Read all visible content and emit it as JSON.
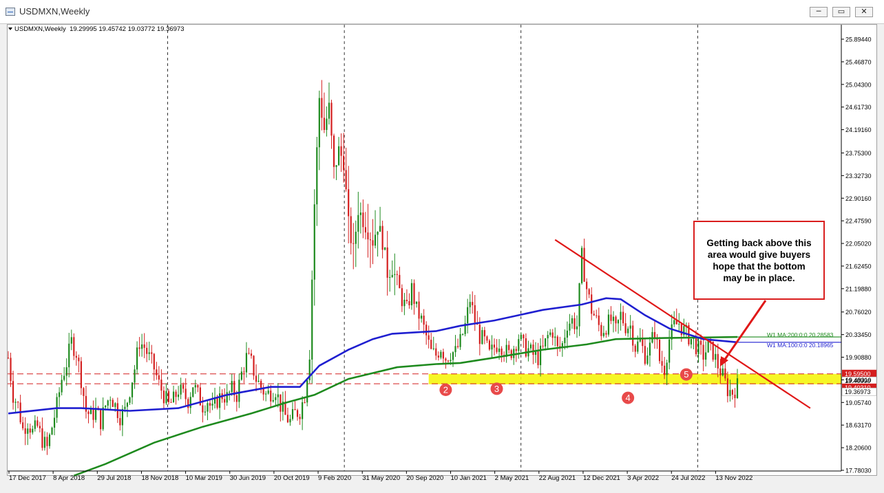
{
  "window": {
    "title": "USDMXN,Weekly",
    "buttons": {
      "minimize": "─",
      "restore": "▭",
      "close": "✕"
    }
  },
  "info_line": {
    "symbol": "USDMXN,Weekly",
    "open": "19.29995",
    "high": "19.45742",
    "low": "19.03772",
    "close": "19.36973"
  },
  "colors": {
    "bull": "#1e8a1e",
    "bear": "#d41f1f",
    "ma100": "#1f1fd0",
    "ma200": "#1e8a1e",
    "trendline": "#e01818",
    "support_zone": "#f5f500",
    "dashed_level": "#d41f1f"
  },
  "chart_data": {
    "type": "line",
    "title": "USDMXN,Weekly",
    "y_axis": {
      "ylim": [
        17.7,
        26.05
      ],
      "tick_labels": [
        "25.89440",
        "25.46870",
        "25.04300",
        "24.61730",
        "24.19160",
        "23.75300",
        "23.32730",
        "22.90160",
        "22.47590",
        "22.05020",
        "21.62450",
        "21.19880",
        "20.76020",
        "20.33450",
        "19.90880",
        "19.48310",
        "19.05740",
        "18.63170",
        "18.20600",
        "17.78030"
      ]
    },
    "x_axis": {
      "tick_labels": [
        "17 Dec 2017",
        "8 Apr 2018",
        "29 Jul 2018",
        "18 Nov 2018",
        "10 Mar 2019",
        "30 Jun 2019",
        "20 Oct 2019",
        "9 Feb 2020",
        "31 May 2020",
        "20 Sep 2020",
        "10 Jan 2021",
        "2 May 2021",
        "22 Aug 2021",
        "12 Dec 2021",
        "3 Apr 2022",
        "24 Jul 2022",
        "13 Nov 2022"
      ],
      "period_grid_after": [
        3,
        7,
        11,
        15
      ]
    },
    "price_path": [
      [
        0,
        19.9
      ],
      [
        2,
        19.2
      ],
      [
        4,
        19.0
      ],
      [
        6,
        18.55
      ],
      [
        8,
        18.7
      ],
      [
        10,
        18.5
      ],
      [
        12,
        18.6
      ],
      [
        14,
        18.35
      ],
      [
        16,
        18.2
      ],
      [
        18,
        18.6
      ],
      [
        20,
        19.0
      ],
      [
        22,
        19.5
      ],
      [
        24,
        19.8
      ],
      [
        26,
        20.2
      ],
      [
        28,
        20.0
      ],
      [
        30,
        19.5
      ],
      [
        32,
        18.9
      ],
      [
        34,
        18.8
      ],
      [
        36,
        18.9
      ],
      [
        38,
        18.7
      ],
      [
        40,
        19.0
      ],
      [
        42,
        19.2
      ],
      [
        44,
        19.0
      ],
      [
        46,
        18.8
      ],
      [
        48,
        18.9
      ],
      [
        50,
        19.3
      ],
      [
        52,
        19.7
      ],
      [
        54,
        20.2
      ],
      [
        56,
        20.1
      ],
      [
        58,
        19.9
      ],
      [
        60,
        19.7
      ],
      [
        62,
        19.4
      ],
      [
        64,
        19.2
      ],
      [
        66,
        19.0
      ],
      [
        68,
        19.1
      ],
      [
        70,
        19.3
      ],
      [
        72,
        19.2
      ],
      [
        74,
        19.1
      ],
      [
        76,
        19.4
      ],
      [
        78,
        19.2
      ],
      [
        80,
        19.0
      ],
      [
        82,
        19.1
      ],
      [
        84,
        18.9
      ],
      [
        86,
        19.1
      ],
      [
        88,
        19.2
      ],
      [
        90,
        19.15
      ],
      [
        92,
        19.3
      ],
      [
        94,
        19.2
      ],
      [
        96,
        19.6
      ],
      [
        98,
        19.9
      ],
      [
        100,
        19.8
      ],
      [
        102,
        19.5
      ],
      [
        104,
        19.35
      ],
      [
        106,
        19.2
      ],
      [
        108,
        19.25
      ],
      [
        110,
        19.3
      ],
      [
        112,
        19.0
      ],
      [
        114,
        18.8
      ],
      [
        116,
        18.7
      ],
      [
        118,
        18.85
      ],
      [
        120,
        18.9
      ],
      [
        122,
        19.2
      ],
      [
        124,
        20.0
      ],
      [
        126,
        22.8
      ],
      [
        128,
        24.8
      ],
      [
        130,
        24.2
      ],
      [
        132,
        24.6
      ],
      [
        134,
        23.4
      ],
      [
        136,
        23.8
      ],
      [
        138,
        23.6
      ],
      [
        140,
        22.4
      ],
      [
        142,
        21.9
      ],
      [
        144,
        22.7
      ],
      [
        146,
        22.5
      ],
      [
        148,
        22.3
      ],
      [
        150,
        22.1
      ],
      [
        152,
        22.4
      ],
      [
        154,
        22.1
      ],
      [
        156,
        21.5
      ],
      [
        158,
        21.6
      ],
      [
        160,
        21.3
      ],
      [
        162,
        21.0
      ],
      [
        164,
        20.8
      ],
      [
        166,
        21.2
      ],
      [
        168,
        20.8
      ],
      [
        170,
        20.6
      ],
      [
        172,
        20.3
      ],
      [
        174,
        20.0
      ],
      [
        176,
        19.95
      ],
      [
        178,
        20.1
      ],
      [
        180,
        19.9
      ],
      [
        182,
        20.0
      ],
      [
        184,
        20.0
      ],
      [
        186,
        20.2
      ],
      [
        188,
        20.5
      ],
      [
        190,
        21.0
      ],
      [
        192,
        20.6
      ],
      [
        194,
        20.3
      ],
      [
        196,
        20.2
      ],
      [
        198,
        19.95
      ],
      [
        200,
        20.1
      ],
      [
        202,
        20.2
      ],
      [
        204,
        20.05
      ],
      [
        206,
        19.95
      ],
      [
        208,
        20.1
      ],
      [
        210,
        20.3
      ],
      [
        212,
        20.1
      ],
      [
        214,
        20.05
      ],
      [
        216,
        19.95
      ],
      [
        218,
        19.9
      ],
      [
        220,
        20.05
      ],
      [
        222,
        20.3
      ],
      [
        224,
        20.4
      ],
      [
        226,
        20.05
      ],
      [
        228,
        20.15
      ],
      [
        230,
        20.55
      ],
      [
        232,
        20.6
      ],
      [
        234,
        20.5
      ],
      [
        236,
        21.8
      ],
      [
        238,
        21.2
      ],
      [
        240,
        20.8
      ],
      [
        242,
        20.6
      ],
      [
        244,
        20.4
      ],
      [
        246,
        20.5
      ],
      [
        248,
        20.6
      ],
      [
        250,
        20.4
      ],
      [
        252,
        20.7
      ],
      [
        254,
        20.5
      ],
      [
        256,
        20.5
      ],
      [
        258,
        20.1
      ],
      [
        260,
        20.2
      ],
      [
        262,
        19.95
      ],
      [
        264,
        20.1
      ],
      [
        266,
        20.4
      ],
      [
        268,
        19.85
      ],
      [
        270,
        19.7
      ],
      [
        272,
        20.25
      ],
      [
        274,
        20.5
      ],
      [
        276,
        20.55
      ],
      [
        278,
        20.4
      ],
      [
        280,
        20.3
      ],
      [
        282,
        20.2
      ],
      [
        284,
        20.05
      ],
      [
        286,
        19.95
      ],
      [
        288,
        20.1
      ],
      [
        290,
        20.0
      ],
      [
        292,
        19.75
      ],
      [
        294,
        19.55
      ],
      [
        296,
        19.3
      ],
      [
        298,
        19.25
      ],
      [
        300,
        19.37
      ]
    ],
    "series": [
      {
        "name": "W1 MA:200:0:0",
        "last_label": "20.28583",
        "values": [
          [
            27,
            17.68
          ],
          [
            40,
            17.9
          ],
          [
            60,
            18.3
          ],
          [
            80,
            18.6
          ],
          [
            100,
            18.85
          ],
          [
            114,
            19.05
          ],
          [
            126,
            19.2
          ],
          [
            140,
            19.5
          ],
          [
            160,
            19.72
          ],
          [
            176,
            19.78
          ],
          [
            186,
            19.8
          ],
          [
            200,
            19.9
          ],
          [
            220,
            20.05
          ],
          [
            238,
            20.15
          ],
          [
            250,
            20.25
          ],
          [
            270,
            20.27
          ],
          [
            300,
            20.29
          ]
        ]
      },
      {
        "name": "W1 MA:100:0:0",
        "last_label": "20.18965",
        "values": [
          [
            0,
            18.85
          ],
          [
            20,
            18.95
          ],
          [
            30,
            18.95
          ],
          [
            50,
            18.9
          ],
          [
            70,
            18.95
          ],
          [
            90,
            19.2
          ],
          [
            108,
            19.35
          ],
          [
            120,
            19.35
          ],
          [
            128,
            19.75
          ],
          [
            140,
            20.05
          ],
          [
            150,
            20.25
          ],
          [
            158,
            20.35
          ],
          [
            176,
            20.4
          ],
          [
            186,
            20.5
          ],
          [
            200,
            20.6
          ],
          [
            220,
            20.8
          ],
          [
            236,
            20.9
          ],
          [
            246,
            21.02
          ],
          [
            252,
            21.0
          ],
          [
            262,
            20.7
          ],
          [
            272,
            20.45
          ],
          [
            286,
            20.25
          ],
          [
            300,
            20.19
          ]
        ]
      }
    ],
    "horizontal_levels": [
      {
        "label": "19.59500",
        "value": 19.595
      },
      {
        "label": "19.40990",
        "value": 19.41
      },
      {
        "label": "19.40310",
        "value": 19.4
      },
      {
        "label": "19.36973",
        "value": 19.37
      }
    ],
    "support_zone": {
      "from_index": 173,
      "to_index": 330,
      "low": 19.4,
      "high": 19.595
    },
    "trendline": {
      "from": [
        225,
        22.12
      ],
      "to": [
        330,
        18.95
      ]
    },
    "markers": [
      {
        "label": "2",
        "index": 180,
        "value": 19.45
      },
      {
        "label": "3",
        "index": 201,
        "value": 19.47
      },
      {
        "label": "4",
        "index": 255,
        "value": 19.3
      },
      {
        "label": "5",
        "index": 279,
        "value": 19.74
      }
    ],
    "annotation": {
      "lines": [
        "Getting back above this",
        "area would give buyers",
        "hope that the bottom",
        "may be in place."
      ]
    }
  }
}
